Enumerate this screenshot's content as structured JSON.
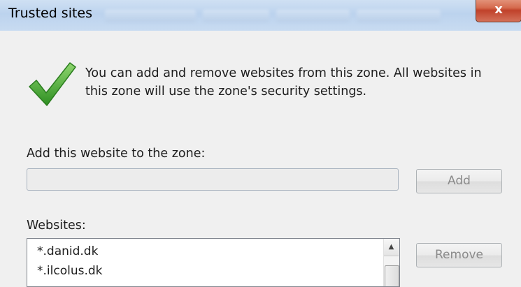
{
  "window": {
    "title": "Trusted sites",
    "close_glyph": "x"
  },
  "info": {
    "icon": "checkmark-icon",
    "text": "You can add and remove websites from this zone. All websites in\nthis zone will use the zone's security settings."
  },
  "add_section": {
    "label": "Add this website to the zone:",
    "input_value": "",
    "add_button": "Add"
  },
  "websites": {
    "label": "Websites:",
    "items": [
      "*.danid.dk",
      "*.ilcolus.dk"
    ],
    "remove_button": "Remove",
    "scroll_up_glyph": "▲"
  },
  "colors": {
    "check_green": "#3aa52c",
    "titlebar": "#bcd3ee",
    "close_red": "#c0412a"
  }
}
